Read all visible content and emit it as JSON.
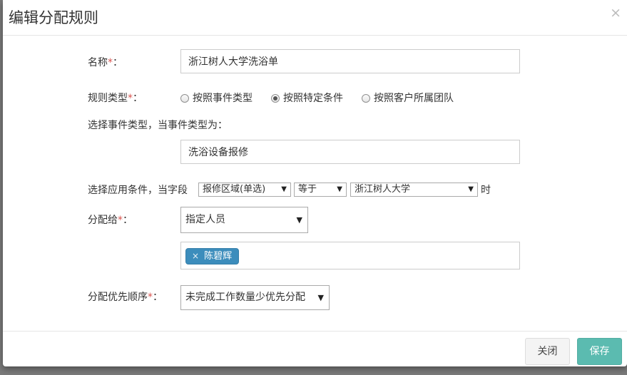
{
  "dialog": {
    "title": "编辑分配规则",
    "close_symbol": "×"
  },
  "form": {
    "name": {
      "label": "名称",
      "required_mark": "*",
      "suffix": "：",
      "value": "浙江树人大学洗浴单"
    },
    "rule_type": {
      "label": "规则类型",
      "required_mark": "*",
      "suffix": "：",
      "options": [
        {
          "label": "按照事件类型",
          "checked": false
        },
        {
          "label": "按照特定条件",
          "checked": true
        },
        {
          "label": "按照客户所属团队",
          "checked": false
        }
      ]
    },
    "event_type": {
      "label": "选择事件类型，当事件类型为：",
      "value": "洗浴设备报修"
    },
    "condition": {
      "label": "选择应用条件，当字段",
      "field": "报修区域(单选)",
      "operator": "等于",
      "value": "浙江树人大学",
      "suffix": "时"
    },
    "assign_to": {
      "label": "分配给",
      "required_mark": "*",
      "suffix": "：",
      "value": "指定人员",
      "tags": [
        "陈碧辉"
      ],
      "tag_remove_symbol": "×"
    },
    "priority": {
      "label": "分配优先顺序",
      "required_mark": "*",
      "suffix": "：",
      "value": "未完成工作数量少优先分配"
    }
  },
  "footer": {
    "close_label": "关闭",
    "save_label": "保存"
  },
  "colors": {
    "primary": "#5bbbb0",
    "tag": "#3c8dbc",
    "required": "#d9534f"
  },
  "icons": {
    "caret": "caret-down-icon",
    "close": "close-icon"
  }
}
